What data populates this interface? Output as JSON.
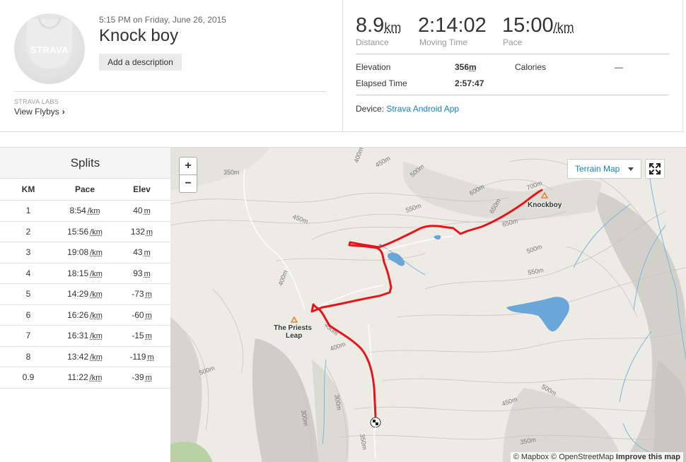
{
  "activity": {
    "datetime": "5:15 PM on Friday, June 26, 2015",
    "title": "Knock boy",
    "add_description_label": "Add a description",
    "avatar_logo": "STRAVA"
  },
  "labs": {
    "title": "STRAVA LABS",
    "view_flybys": "View Flybys",
    "chevron_icon": "chevron-right-icon"
  },
  "stats": {
    "distance": {
      "value": "8.9",
      "unit": "km",
      "label": "Distance"
    },
    "moving_time": {
      "value": "2:14:02",
      "label": "Moving Time"
    },
    "pace": {
      "value": "15:00",
      "unit": "/km",
      "label": "Pace"
    },
    "elevation_label": "Elevation",
    "elevation_value": "356",
    "elevation_unit": "m",
    "calories_label": "Calories",
    "calories_value": "—",
    "elapsed_label": "Elapsed Time",
    "elapsed_value": "2:57:47",
    "device_label": "Device:",
    "device_value": "Strava Android App"
  },
  "splits": {
    "title": "Splits",
    "headers": {
      "km": "KM",
      "pace": "Pace",
      "elev": "Elev"
    },
    "pace_unit": "/km",
    "elev_unit": "m",
    "rows": [
      {
        "km": "1",
        "pace": "8:54",
        "elev": "40"
      },
      {
        "km": "2",
        "pace": "15:56",
        "elev": "132"
      },
      {
        "km": "3",
        "pace": "19:08",
        "elev": "43"
      },
      {
        "km": "4",
        "pace": "18:15",
        "elev": "93"
      },
      {
        "km": "5",
        "pace": "14:29",
        "elev": "-73"
      },
      {
        "km": "6",
        "pace": "16:26",
        "elev": "-60"
      },
      {
        "km": "7",
        "pace": "16:31",
        "elev": "-15"
      },
      {
        "km": "8",
        "pace": "13:42",
        "elev": "-119"
      },
      {
        "km": "0.9",
        "pace": "11:22",
        "elev": "-39"
      }
    ]
  },
  "map": {
    "zoom_in": "+",
    "zoom_out": "−",
    "layer": "Terrain Map",
    "fullscreen_icon": "fullscreen-icon",
    "peaks": {
      "knockboy": "Knockboy",
      "priests_leap_1": "The Priests",
      "priests_leap_2": "Leap"
    },
    "contours": [
      "350m",
      "400m",
      "450m",
      "500m",
      "550m",
      "600m",
      "650m",
      "700m",
      "450m",
      "400m",
      "400m",
      "450m",
      "500m",
      "300m",
      "300m",
      "350m",
      "550m",
      "500m",
      "500m",
      "450m",
      "350m",
      "650m"
    ],
    "attribution": "© Mapbox © OpenStreetMap",
    "improve": "Improve this map",
    "route_color": "#e8141c",
    "water_color": "#6ba6d8"
  }
}
